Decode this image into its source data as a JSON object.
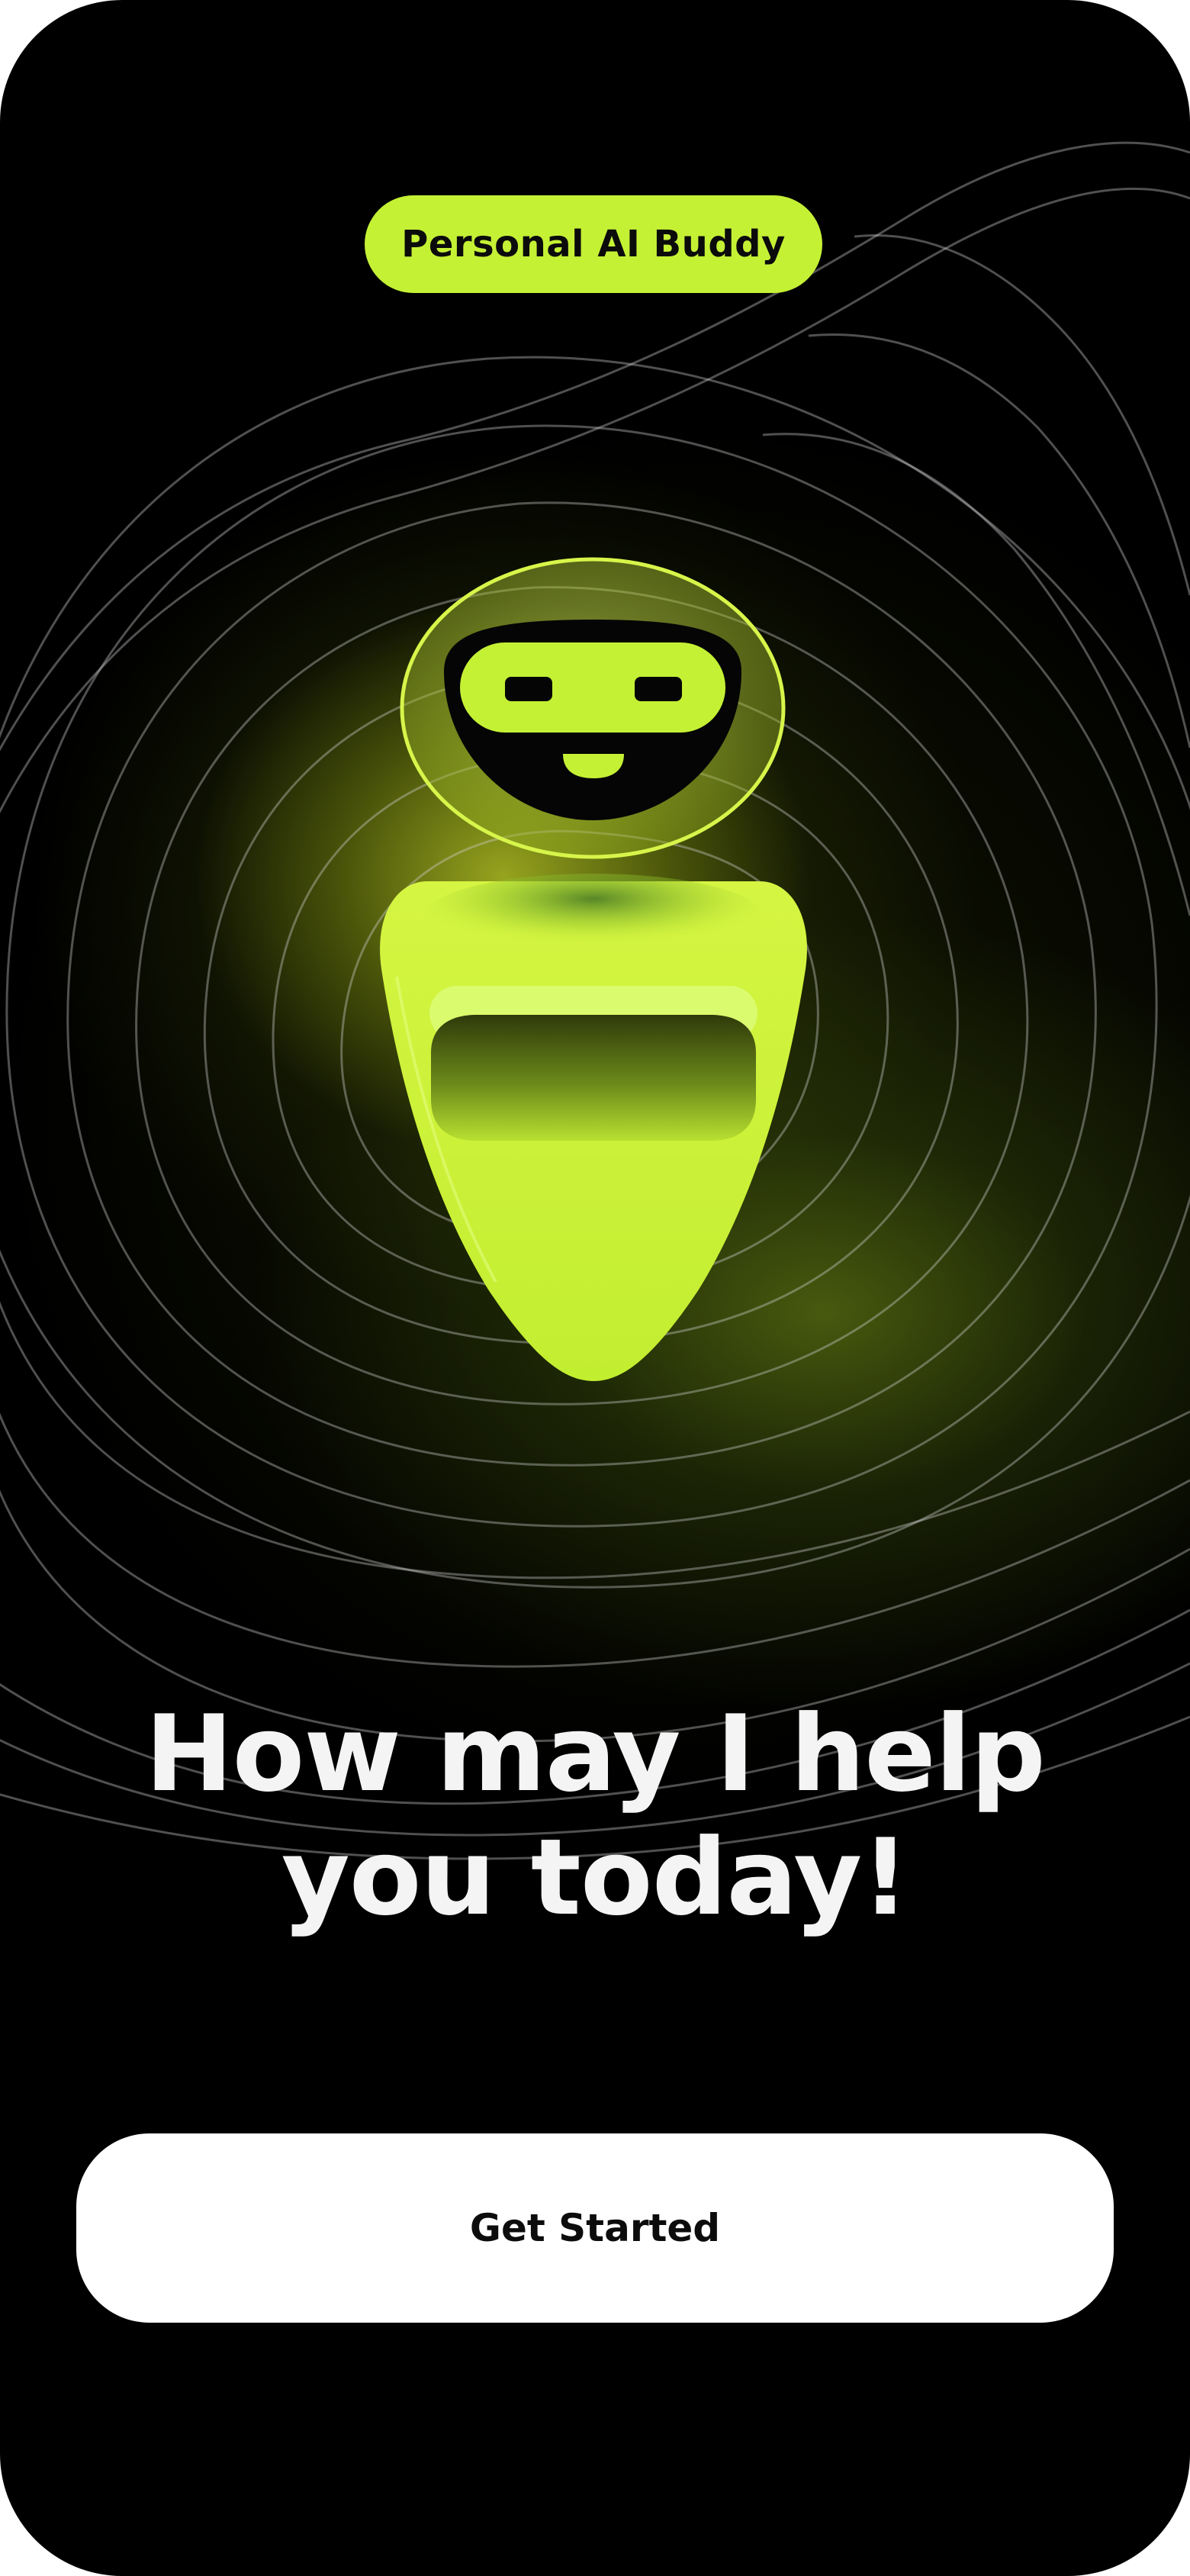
{
  "badge": {
    "label": "Personal AI Buddy"
  },
  "hero": {
    "line1": "How may I help",
    "line2": "you today!"
  },
  "cta": {
    "label": "Get Started"
  },
  "colors": {
    "background": "#000000",
    "accent": "#c5f135",
    "text": "#f4f4f4",
    "button": "#ffffff"
  },
  "icons": [
    "robot-mascot-illustration"
  ]
}
